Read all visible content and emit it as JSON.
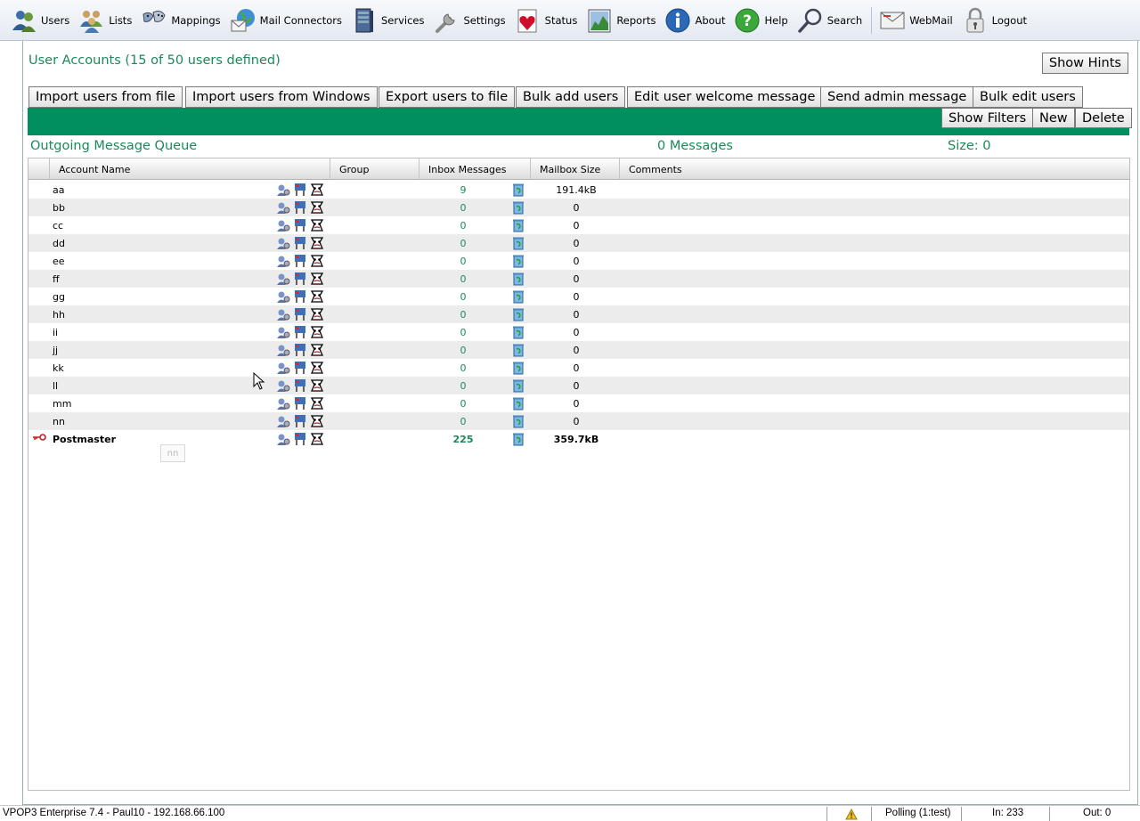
{
  "toolbar": {
    "items": [
      {
        "label": "Users",
        "icon": "users-icon"
      },
      {
        "label": "Lists",
        "icon": "lists-icon"
      },
      {
        "label": "Mappings",
        "icon": "mappings-icon"
      },
      {
        "label": "Mail Connectors",
        "icon": "mail-connectors-icon"
      },
      {
        "label": "Services",
        "icon": "services-icon"
      },
      {
        "label": "Settings",
        "icon": "settings-icon"
      },
      {
        "label": "Status",
        "icon": "status-icon"
      },
      {
        "label": "Reports",
        "icon": "reports-icon"
      },
      {
        "label": "About",
        "icon": "about-icon"
      },
      {
        "label": "Help",
        "icon": "help-icon"
      },
      {
        "label": "Search",
        "icon": "search-icon"
      },
      {
        "label": "WebMail",
        "icon": "webmail-icon"
      },
      {
        "label": "Logout",
        "icon": "logout-icon"
      }
    ]
  },
  "page": {
    "title": "User Accounts (15 of 50 users defined)",
    "show_hints": "Show Hints"
  },
  "actions": {
    "import_file": "Import users from file",
    "import_windows": "Import users from Windows",
    "export_file": "Export users to file",
    "bulk_add": "Bulk add users",
    "welcome_msg": "Edit user welcome message",
    "admin_msg": "Send admin message",
    "bulk_edit": "Bulk edit users",
    "show_filters": "Show Filters",
    "new": "New",
    "delete": "Delete"
  },
  "queue": {
    "label": "Outgoing Message Queue",
    "messages": "0 Messages",
    "size": "Size: 0"
  },
  "table": {
    "columns": [
      "Account Name",
      "Group",
      "Inbox Messages",
      "Mailbox Size",
      "Comments"
    ],
    "rows": [
      {
        "name": "aa",
        "inbox": "9",
        "size": "191.4kB"
      },
      {
        "name": "bb",
        "inbox": "0",
        "size": "0"
      },
      {
        "name": "cc",
        "inbox": "0",
        "size": "0"
      },
      {
        "name": "dd",
        "inbox": "0",
        "size": "0"
      },
      {
        "name": "ee",
        "inbox": "0",
        "size": "0"
      },
      {
        "name": "ff",
        "inbox": "0",
        "size": "0"
      },
      {
        "name": "gg",
        "inbox": "0",
        "size": "0"
      },
      {
        "name": "hh",
        "inbox": "0",
        "size": "0"
      },
      {
        "name": "ii",
        "inbox": "0",
        "size": "0"
      },
      {
        "name": "jj",
        "inbox": "0",
        "size": "0"
      },
      {
        "name": "kk",
        "inbox": "0",
        "size": "0"
      },
      {
        "name": "ll",
        "inbox": "0",
        "size": "0"
      },
      {
        "name": "mm",
        "inbox": "0",
        "size": "0"
      },
      {
        "name": "nn",
        "inbox": "0",
        "size": "0"
      },
      {
        "name": "Postmaster",
        "inbox": "225",
        "size": "359.7kB"
      }
    ]
  },
  "tooltip": "nn",
  "status_bar": {
    "app": "VPOP3 Enterprise 7.4 - Paul10 - 192.168.66.100",
    "polling": "Polling (1:test)",
    "in": "In: 233",
    "out": "Out: 0"
  },
  "colors": {
    "accent_green": "#009060",
    "title_green": "#1a8a5a"
  }
}
